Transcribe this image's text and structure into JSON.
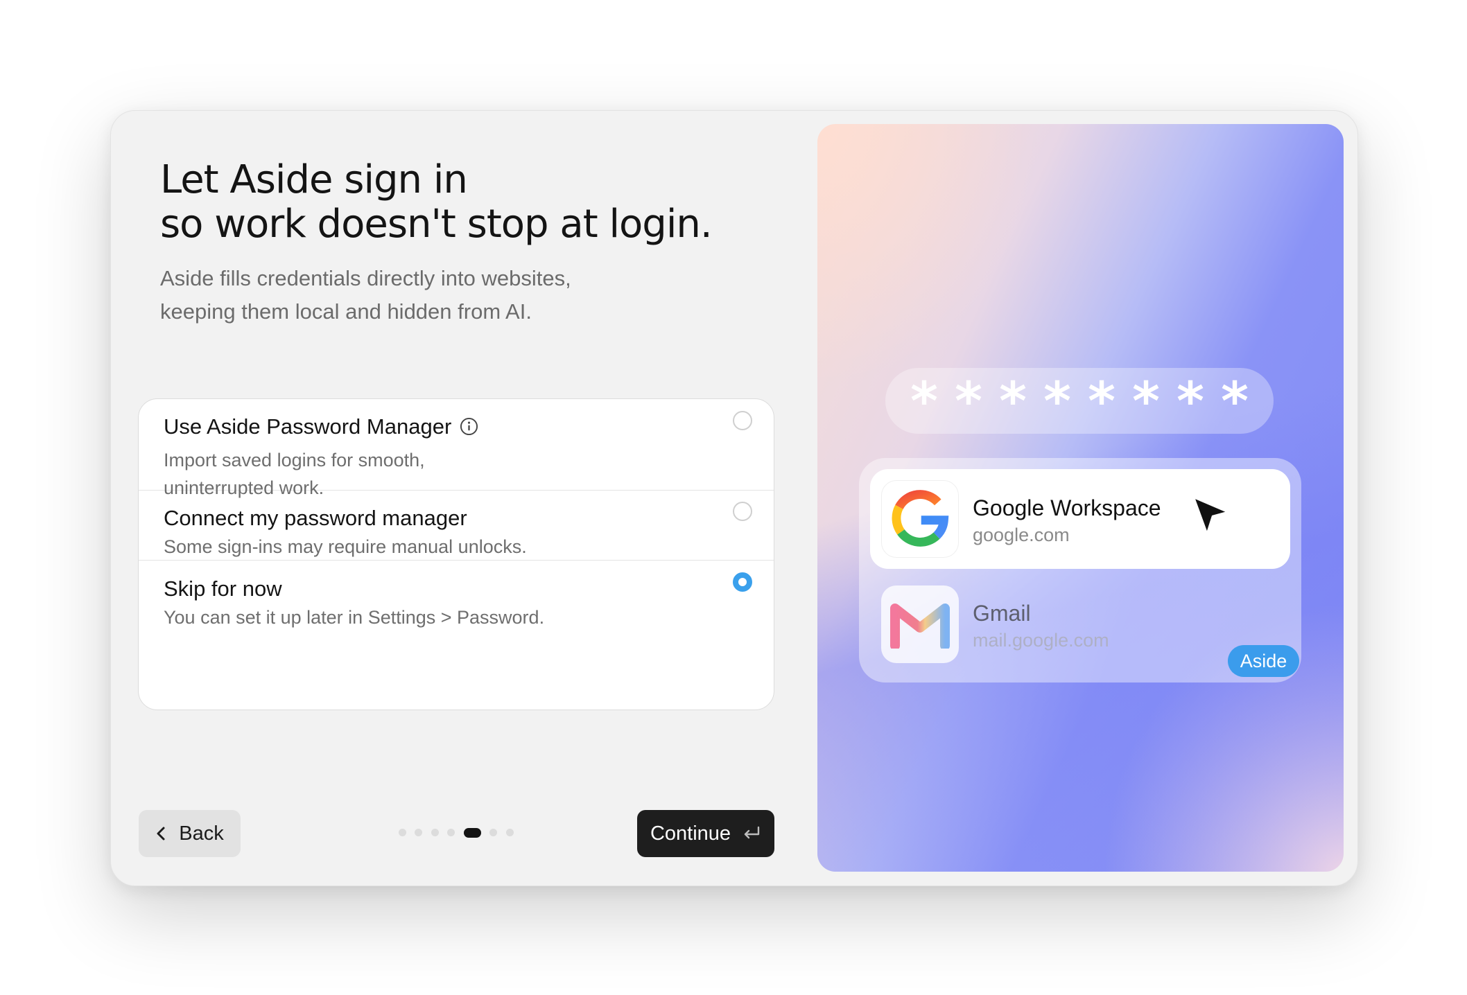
{
  "title": [
    "Let Aside sign in",
    "so work doesn't stop at login."
  ],
  "subtitle": [
    "Aside fills credentials directly into websites,",
    "keeping them local and hidden from AI."
  ],
  "options": [
    {
      "label": "Use Aside Password Manager",
      "description": [
        "Import saved logins for smooth,",
        "uninterrupted work."
      ],
      "selected": false,
      "has_info": true
    },
    {
      "label": "Connect my password manager",
      "description": [
        "Some sign-ins may require manual unlocks."
      ],
      "selected": false
    },
    {
      "label": "Skip for now",
      "description": [
        "You can set it up later in Settings > Password."
      ],
      "selected": true
    }
  ],
  "footer": {
    "back_label": "Back",
    "continue_label": "Continue",
    "steps_total": 7,
    "steps_current": 5
  },
  "illustration": {
    "password_mask": [
      "*",
      "*",
      "*",
      "*",
      "*",
      "*",
      "*",
      "*"
    ],
    "accounts": [
      {
        "name": "Google Workspace",
        "url": "google.com",
        "icon": "google-logo-icon",
        "selected": true
      },
      {
        "name": "Gmail",
        "url": "mail.google.com",
        "icon": "gmail-logo-icon",
        "selected": false
      }
    ],
    "badge": "Aside"
  },
  "colors": {
    "accent": "#3aa0ec",
    "primary_button": "#1e1e1e",
    "badge": "#3b9cec",
    "window_bg": "#f2f2f2"
  }
}
